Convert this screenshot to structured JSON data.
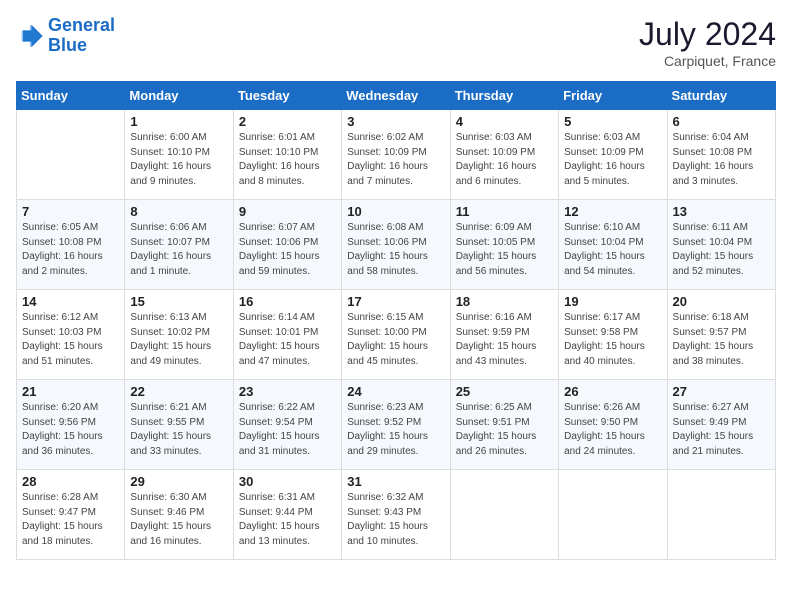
{
  "header": {
    "logo_line1": "General",
    "logo_line2": "Blue",
    "month_year": "July 2024",
    "location": "Carpiquet, France"
  },
  "columns": [
    "Sunday",
    "Monday",
    "Tuesday",
    "Wednesday",
    "Thursday",
    "Friday",
    "Saturday"
  ],
  "weeks": [
    [
      {
        "day": "",
        "info": ""
      },
      {
        "day": "1",
        "info": "Sunrise: 6:00 AM\nSunset: 10:10 PM\nDaylight: 16 hours\nand 9 minutes."
      },
      {
        "day": "2",
        "info": "Sunrise: 6:01 AM\nSunset: 10:10 PM\nDaylight: 16 hours\nand 8 minutes."
      },
      {
        "day": "3",
        "info": "Sunrise: 6:02 AM\nSunset: 10:09 PM\nDaylight: 16 hours\nand 7 minutes."
      },
      {
        "day": "4",
        "info": "Sunrise: 6:03 AM\nSunset: 10:09 PM\nDaylight: 16 hours\nand 6 minutes."
      },
      {
        "day": "5",
        "info": "Sunrise: 6:03 AM\nSunset: 10:09 PM\nDaylight: 16 hours\nand 5 minutes."
      },
      {
        "day": "6",
        "info": "Sunrise: 6:04 AM\nSunset: 10:08 PM\nDaylight: 16 hours\nand 3 minutes."
      }
    ],
    [
      {
        "day": "7",
        "info": "Sunrise: 6:05 AM\nSunset: 10:08 PM\nDaylight: 16 hours\nand 2 minutes."
      },
      {
        "day": "8",
        "info": "Sunrise: 6:06 AM\nSunset: 10:07 PM\nDaylight: 16 hours\nand 1 minute."
      },
      {
        "day": "9",
        "info": "Sunrise: 6:07 AM\nSunset: 10:06 PM\nDaylight: 15 hours\nand 59 minutes."
      },
      {
        "day": "10",
        "info": "Sunrise: 6:08 AM\nSunset: 10:06 PM\nDaylight: 15 hours\nand 58 minutes."
      },
      {
        "day": "11",
        "info": "Sunrise: 6:09 AM\nSunset: 10:05 PM\nDaylight: 15 hours\nand 56 minutes."
      },
      {
        "day": "12",
        "info": "Sunrise: 6:10 AM\nSunset: 10:04 PM\nDaylight: 15 hours\nand 54 minutes."
      },
      {
        "day": "13",
        "info": "Sunrise: 6:11 AM\nSunset: 10:04 PM\nDaylight: 15 hours\nand 52 minutes."
      }
    ],
    [
      {
        "day": "14",
        "info": "Sunrise: 6:12 AM\nSunset: 10:03 PM\nDaylight: 15 hours\nand 51 minutes."
      },
      {
        "day": "15",
        "info": "Sunrise: 6:13 AM\nSunset: 10:02 PM\nDaylight: 15 hours\nand 49 minutes."
      },
      {
        "day": "16",
        "info": "Sunrise: 6:14 AM\nSunset: 10:01 PM\nDaylight: 15 hours\nand 47 minutes."
      },
      {
        "day": "17",
        "info": "Sunrise: 6:15 AM\nSunset: 10:00 PM\nDaylight: 15 hours\nand 45 minutes."
      },
      {
        "day": "18",
        "info": "Sunrise: 6:16 AM\nSunset: 9:59 PM\nDaylight: 15 hours\nand 43 minutes."
      },
      {
        "day": "19",
        "info": "Sunrise: 6:17 AM\nSunset: 9:58 PM\nDaylight: 15 hours\nand 40 minutes."
      },
      {
        "day": "20",
        "info": "Sunrise: 6:18 AM\nSunset: 9:57 PM\nDaylight: 15 hours\nand 38 minutes."
      }
    ],
    [
      {
        "day": "21",
        "info": "Sunrise: 6:20 AM\nSunset: 9:56 PM\nDaylight: 15 hours\nand 36 minutes."
      },
      {
        "day": "22",
        "info": "Sunrise: 6:21 AM\nSunset: 9:55 PM\nDaylight: 15 hours\nand 33 minutes."
      },
      {
        "day": "23",
        "info": "Sunrise: 6:22 AM\nSunset: 9:54 PM\nDaylight: 15 hours\nand 31 minutes."
      },
      {
        "day": "24",
        "info": "Sunrise: 6:23 AM\nSunset: 9:52 PM\nDaylight: 15 hours\nand 29 minutes."
      },
      {
        "day": "25",
        "info": "Sunrise: 6:25 AM\nSunset: 9:51 PM\nDaylight: 15 hours\nand 26 minutes."
      },
      {
        "day": "26",
        "info": "Sunrise: 6:26 AM\nSunset: 9:50 PM\nDaylight: 15 hours\nand 24 minutes."
      },
      {
        "day": "27",
        "info": "Sunrise: 6:27 AM\nSunset: 9:49 PM\nDaylight: 15 hours\nand 21 minutes."
      }
    ],
    [
      {
        "day": "28",
        "info": "Sunrise: 6:28 AM\nSunset: 9:47 PM\nDaylight: 15 hours\nand 18 minutes."
      },
      {
        "day": "29",
        "info": "Sunrise: 6:30 AM\nSunset: 9:46 PM\nDaylight: 15 hours\nand 16 minutes."
      },
      {
        "day": "30",
        "info": "Sunrise: 6:31 AM\nSunset: 9:44 PM\nDaylight: 15 hours\nand 13 minutes."
      },
      {
        "day": "31",
        "info": "Sunrise: 6:32 AM\nSunset: 9:43 PM\nDaylight: 15 hours\nand 10 minutes."
      },
      {
        "day": "",
        "info": ""
      },
      {
        "day": "",
        "info": ""
      },
      {
        "day": "",
        "info": ""
      }
    ]
  ]
}
